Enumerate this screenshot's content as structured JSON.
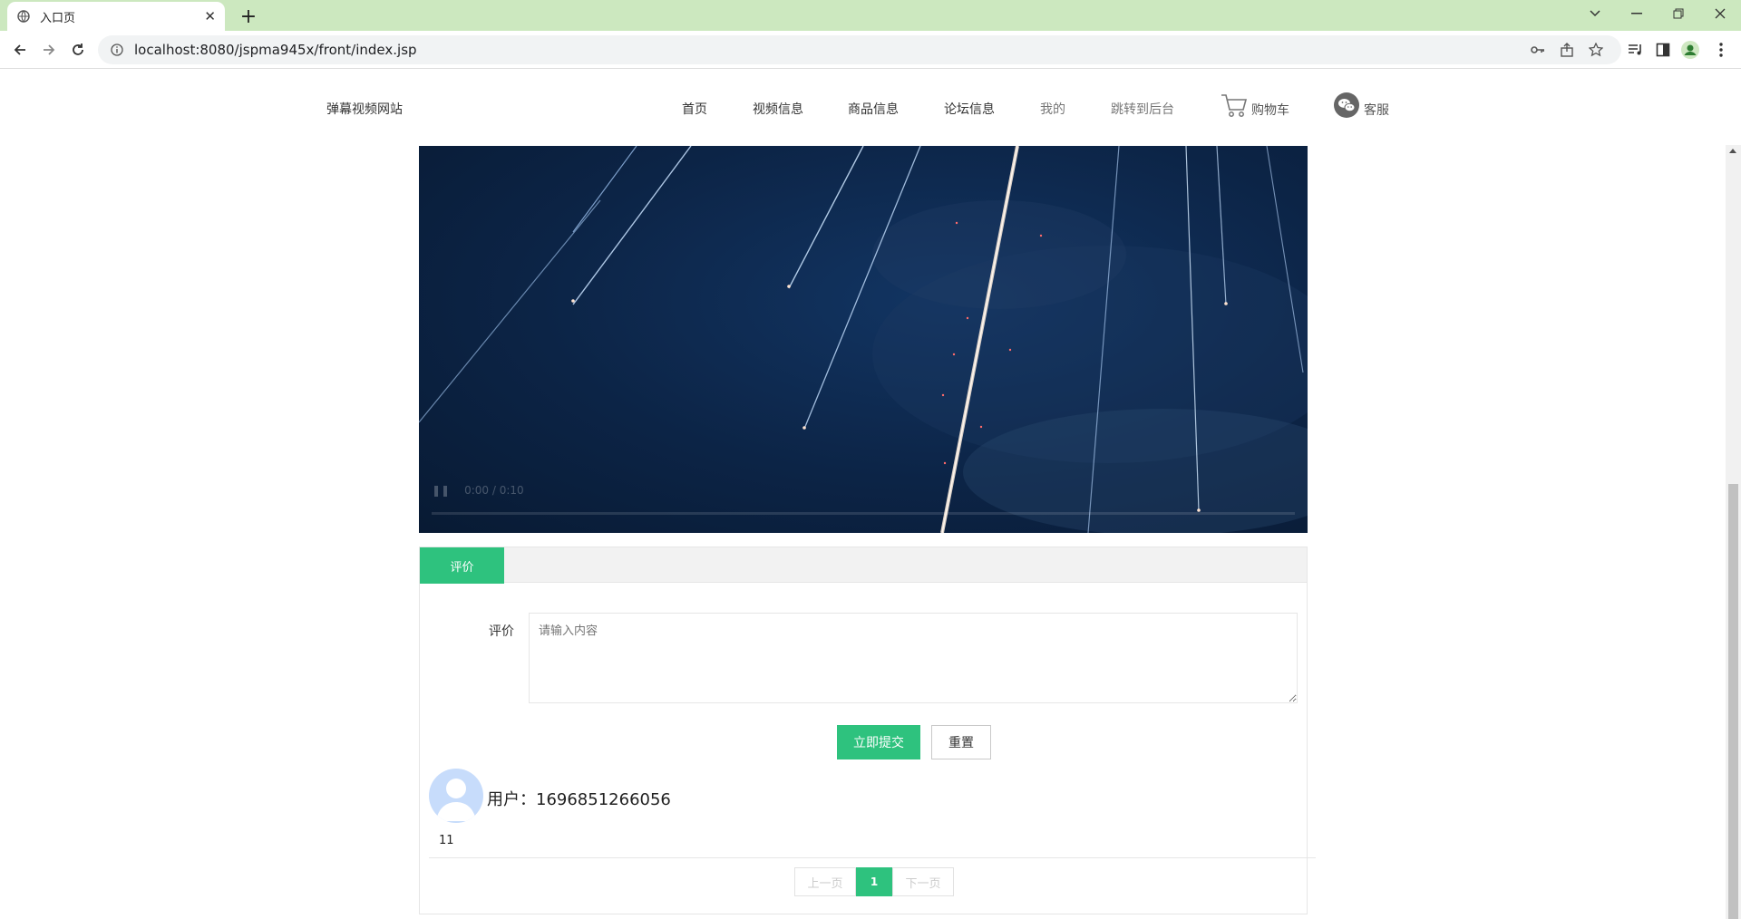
{
  "browser": {
    "tab_title": "入口页",
    "url": "localhost:8080/jspma945x/front/index.jsp"
  },
  "header": {
    "site_name": "弹幕视频网站",
    "nav": [
      {
        "label": "首页"
      },
      {
        "label": "视频信息"
      },
      {
        "label": "商品信息"
      },
      {
        "label": "论坛信息"
      },
      {
        "label": "我的"
      },
      {
        "label": "跳转到后台"
      }
    ],
    "cart_label": "购物车",
    "service_label": "客服"
  },
  "video": {
    "time": "0:00 / 0:10"
  },
  "comments": {
    "tab_label": "评价",
    "form_label": "评价",
    "placeholder": "请输入内容",
    "submit_label": "立即提交",
    "reset_label": "重置",
    "items": [
      {
        "user": "用户：1696851266056",
        "content": "11"
      }
    ]
  },
  "pager": {
    "prev": "上一页",
    "current": "1",
    "next": "下一页"
  },
  "colors": {
    "accent": "#2ec27e",
    "chrome_tabbar": "#cce8bf"
  }
}
